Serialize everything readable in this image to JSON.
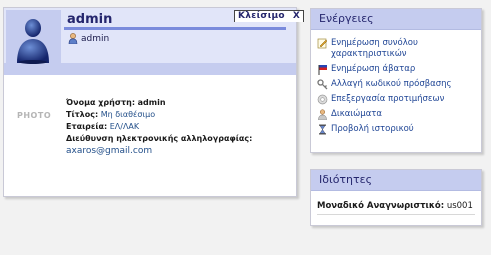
{
  "profile": {
    "username": "admin",
    "close_label": "Κλείσιμο",
    "close_x": "X",
    "user_link": "admin",
    "photo_label": "PHOTO",
    "fields": {
      "username_label": "Όνομα χρήστη:",
      "username_value": "admin",
      "title_label": "Τίτλος:",
      "title_value": "Μη διαθέσιμο",
      "company_label": "Εταιρεία:",
      "company_value": "ΕΛ/ΛΑΚ",
      "email_label": "Διεύθυνση ηλεκτρονικής αλληλογραφίας:",
      "email_value": "axaros@gmail.com"
    }
  },
  "actions": {
    "title": "Ενέργειες",
    "items": [
      {
        "label": "Ενημέρωση συνόλου χαρακτηριστικών",
        "icon": "edit-icon"
      },
      {
        "label": "Ενημέρωση άβαταρ",
        "icon": "flag-icon"
      },
      {
        "label": "Αλλαγή κωδικού πρόσβασης",
        "icon": "key-icon"
      },
      {
        "label": "Επεξεργασία προτιμήσεων",
        "icon": "preferences-icon"
      },
      {
        "label": "Δικαιώματα",
        "icon": "user-permissions-icon"
      },
      {
        "label": "Προβολή ιστορικού",
        "icon": "hourglass-icon"
      }
    ]
  },
  "properties": {
    "title": "Ιδιότητες",
    "unique_id_label": "Μοναδικό Αναγνωριστικό:",
    "unique_id_value": "us001"
  },
  "colors": {
    "panel_header": "#c5ccef",
    "link": "#1f4595",
    "title_text": "#25266d"
  }
}
